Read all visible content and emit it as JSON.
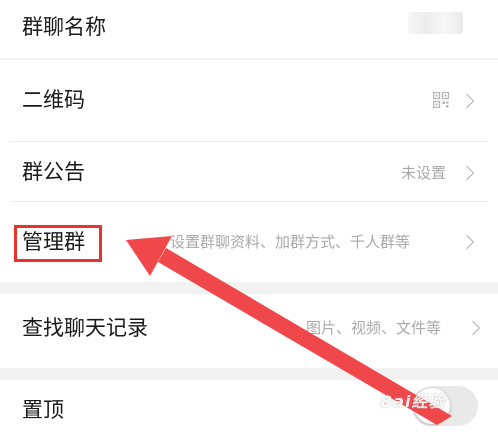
{
  "rows": {
    "group_name": {
      "title": "群聊名称"
    },
    "qrcode": {
      "title": "二维码",
      "icon": "qr-code-icon"
    },
    "notice": {
      "title": "群公告",
      "value": "未设置"
    },
    "manage": {
      "title": "管理群",
      "value": "设置群聊资料、加群方式、千人群等"
    },
    "search_history": {
      "title": "查找聊天记录",
      "value": "图片、视频、文件等"
    },
    "pin_top": {
      "title": "置顶",
      "toggle_on": false
    }
  },
  "annotation": {
    "highlight_color": "#e8322e",
    "arrow_color": "#f0484a",
    "watermark": "Bai经验"
  }
}
